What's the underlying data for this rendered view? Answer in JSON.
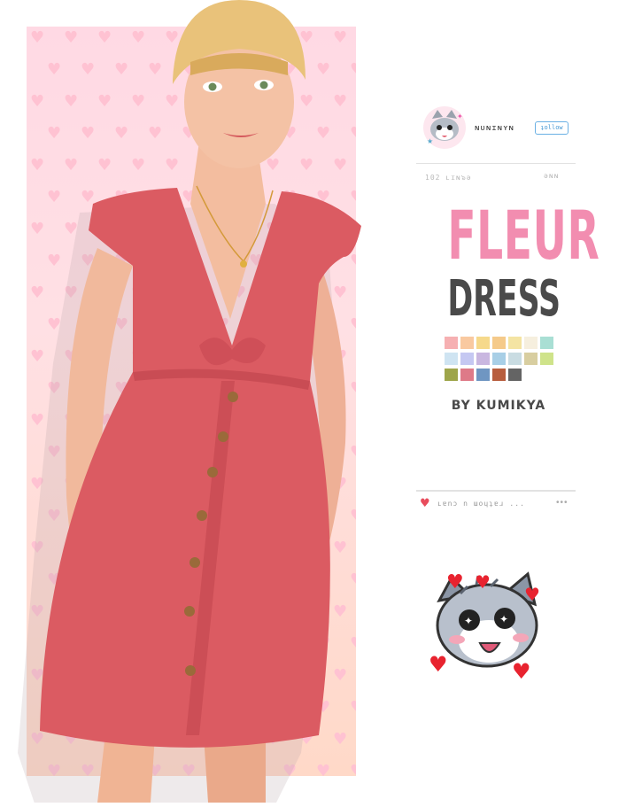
{
  "profile": {
    "username": "ɴᴜɴɪɴʏɴ",
    "follow_label": "ʇollow",
    "stat_left": "102 ʟɪɴ๖ǝ",
    "stat_right": "ǝɴɴ"
  },
  "title": {
    "line1": "FLEUR",
    "line2": "DRESS",
    "byline": "BY KUMIKYA"
  },
  "swatches": [
    "#f6b0b2",
    "#f9c9a0",
    "#f6d98b",
    "#f5ca8a",
    "#f4e4a3",
    "#f6efde",
    "#a9dfd4",
    "#cfe4f2",
    "#c5c8f2",
    "#c9b7e0",
    "#a8cfe6",
    "#c9dce2",
    "#d8ceA0",
    "#cfe38a",
    "#9ea54a",
    "#de7a88",
    "#6f96c2",
    "#b85e3e",
    "#646464"
  ],
  "like": {
    "text": "ʟɐnɔ n ɯoɥʇɐɹ ..."
  },
  "colors": {
    "title_pink": "#f28db0",
    "title_dark": "#4a4a4a",
    "panel_pink": "#ffd9e4",
    "follow_blue": "#6ab0e4",
    "heart_red": "#e84c5c"
  },
  "icons": [
    "cat-avatar-icon",
    "heart-icon",
    "more-icon",
    "cat-sticker-icon"
  ]
}
